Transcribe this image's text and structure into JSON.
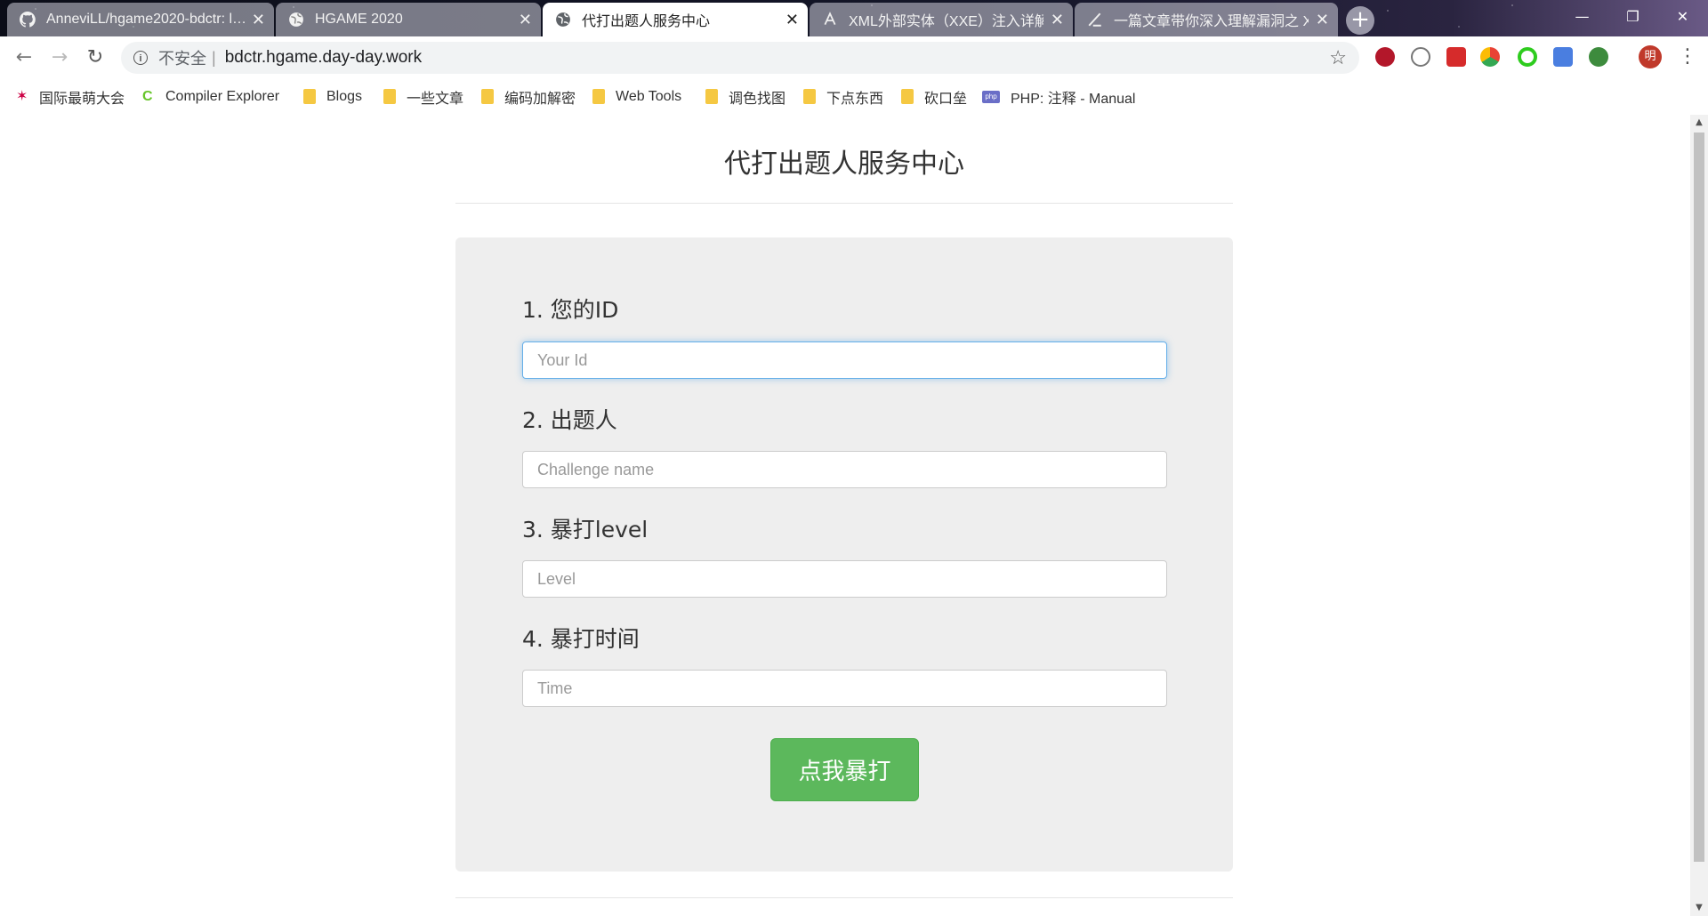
{
  "browser": {
    "tabs": [
      {
        "title": "AnneviLL/hgame2020-bdctr: l…",
        "icon": "github-icon",
        "active": false
      },
      {
        "title": "HGAME 2020",
        "icon": "globe-icon",
        "active": false
      },
      {
        "title": "代打出题人服务中心",
        "icon": "globe-icon",
        "active": true
      },
      {
        "title": "XML外部实体（XXE）注入详解",
        "icon": "site-icon",
        "active": false
      },
      {
        "title": "一篇文章带你深入理解漏洞之 X…",
        "icon": "site-icon",
        "active": false
      }
    ],
    "tab_close": "✕",
    "new_tab": "+",
    "window_controls": {
      "minimize": "—",
      "maximize": "❐",
      "close": "✕"
    },
    "address": {
      "security_label": "不安全",
      "separator": "|",
      "url": "bdctr.hgame.day-day.work"
    },
    "bookmarks": [
      {
        "label": "国际最萌大会",
        "icon": "star-logo-icon"
      },
      {
        "label": "Compiler Explorer",
        "icon": "compiler-explorer-icon"
      },
      {
        "label": "Blogs",
        "icon": "folder-icon"
      },
      {
        "label": "一些文章",
        "icon": "folder-icon"
      },
      {
        "label": "编码加解密",
        "icon": "folder-icon"
      },
      {
        "label": "Web Tools",
        "icon": "folder-icon"
      },
      {
        "label": "调色找图",
        "icon": "folder-icon"
      },
      {
        "label": "下点东西",
        "icon": "folder-icon"
      },
      {
        "label": "砍口垒",
        "icon": "folder-icon"
      },
      {
        "label": "PHP: 注释 - Manual",
        "icon": "php-icon"
      }
    ],
    "profile_avatar_letter": "明"
  },
  "page": {
    "title": "代打出题人服务中心",
    "fields": [
      {
        "label": "1. 您的ID",
        "placeholder": "Your Id",
        "value": ""
      },
      {
        "label": "2. 出题人",
        "placeholder": "Challenge name",
        "value": ""
      },
      {
        "label": "3. 暴打level",
        "placeholder": "Level",
        "value": ""
      },
      {
        "label": "4. 暴打时间",
        "placeholder": "Time",
        "value": ""
      }
    ],
    "submit_label": "点我暴打"
  },
  "colors": {
    "submit_button": "#5cb85c",
    "form_background": "#eeeeee",
    "focus_border": "#66afe9"
  }
}
